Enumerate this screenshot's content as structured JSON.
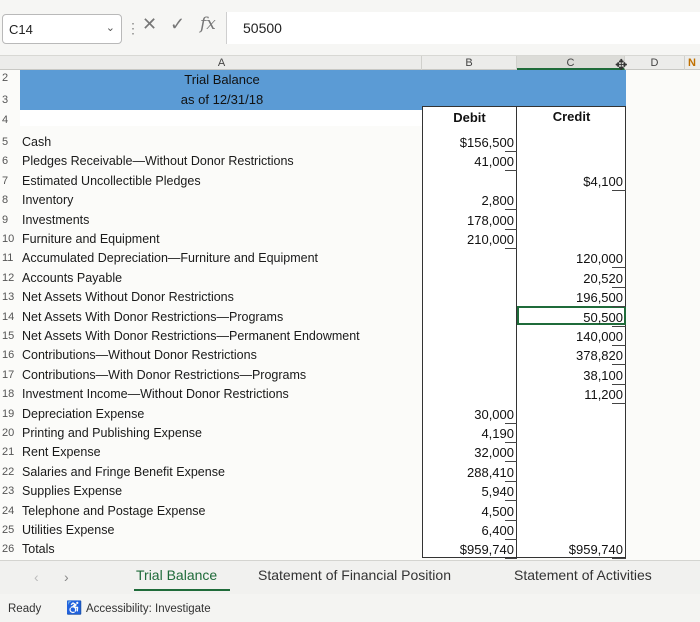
{
  "formula_bar": {
    "name_box": "C14",
    "cancel_icon": "✕",
    "enter_icon": "✓",
    "function_icon": "fx",
    "value": "50500"
  },
  "columns": [
    "A",
    "B",
    "C",
    "D",
    "N"
  ],
  "title_line1": "Trial Balance",
  "title_line2": "as of 12/31/18",
  "header_rows": [
    "2",
    "3",
    "4"
  ],
  "debit_header": "Debit",
  "credit_header": "Credit",
  "rows": [
    {
      "num": "5",
      "account": "Cash",
      "debit": "$156,500",
      "credit": ""
    },
    {
      "num": "6",
      "account": "Pledges Receivable—Without Donor Restrictions",
      "debit": "41,000",
      "credit": ""
    },
    {
      "num": "7",
      "account": "Estimated Uncollectible Pledges",
      "debit": "",
      "credit": "$4,100"
    },
    {
      "num": "8",
      "account": "Inventory",
      "debit": "2,800",
      "credit": ""
    },
    {
      "num": "9",
      "account": "Investments",
      "debit": "178,000",
      "credit": ""
    },
    {
      "num": "10",
      "account": "Furniture and Equipment",
      "debit": "210,000",
      "credit": ""
    },
    {
      "num": "11",
      "account": "Accumulated Depreciation—Furniture and Equipment",
      "debit": "",
      "credit": "120,000"
    },
    {
      "num": "12",
      "account": "Accounts Payable",
      "debit": "",
      "credit": "20,520"
    },
    {
      "num": "13",
      "account": "Net Assets Without Donor Restrictions",
      "debit": "",
      "credit": "196,500"
    },
    {
      "num": "14",
      "account": "Net Assets With Donor Restrictions—Programs",
      "debit": "",
      "credit": "50,500"
    },
    {
      "num": "15",
      "account": "Net Assets With Donor Restrictions—Permanent Endowment",
      "debit": "",
      "credit": "140,000"
    },
    {
      "num": "16",
      "account": "Contributions—Without Donor Restrictions",
      "debit": "",
      "credit": "378,820"
    },
    {
      "num": "17",
      "account": "Contributions—With Donor Restrictions—Programs",
      "debit": "",
      "credit": "38,100"
    },
    {
      "num": "18",
      "account": "Investment Income—Without Donor Restrictions",
      "debit": "",
      "credit": "11,200"
    },
    {
      "num": "19",
      "account": "Depreciation Expense",
      "debit": "30,000",
      "credit": ""
    },
    {
      "num": "20",
      "account": "Printing and Publishing Expense",
      "debit": "4,190",
      "credit": ""
    },
    {
      "num": "21",
      "account": "Rent Expense",
      "debit": "32,000",
      "credit": ""
    },
    {
      "num": "22",
      "account": "Salaries and Fringe Benefit Expense",
      "debit": "288,410",
      "credit": ""
    },
    {
      "num": "23",
      "account": "Supplies Expense",
      "debit": "5,940",
      "credit": ""
    },
    {
      "num": "24",
      "account": "Telephone and Postage Expense",
      "debit": "4,500",
      "credit": ""
    },
    {
      "num": "25",
      "account": "Utilities Expense",
      "debit": "6,400",
      "credit": ""
    },
    {
      "num": "26",
      "account": "Totals",
      "debit": "$959,740",
      "credit": "$959,740"
    }
  ],
  "sheet_tabs": [
    "Trial Balance",
    "Statement of Financial Position",
    "Statement of Activities"
  ],
  "status": {
    "ready": "Ready",
    "accessibility": "Accessibility: Investigate"
  }
}
